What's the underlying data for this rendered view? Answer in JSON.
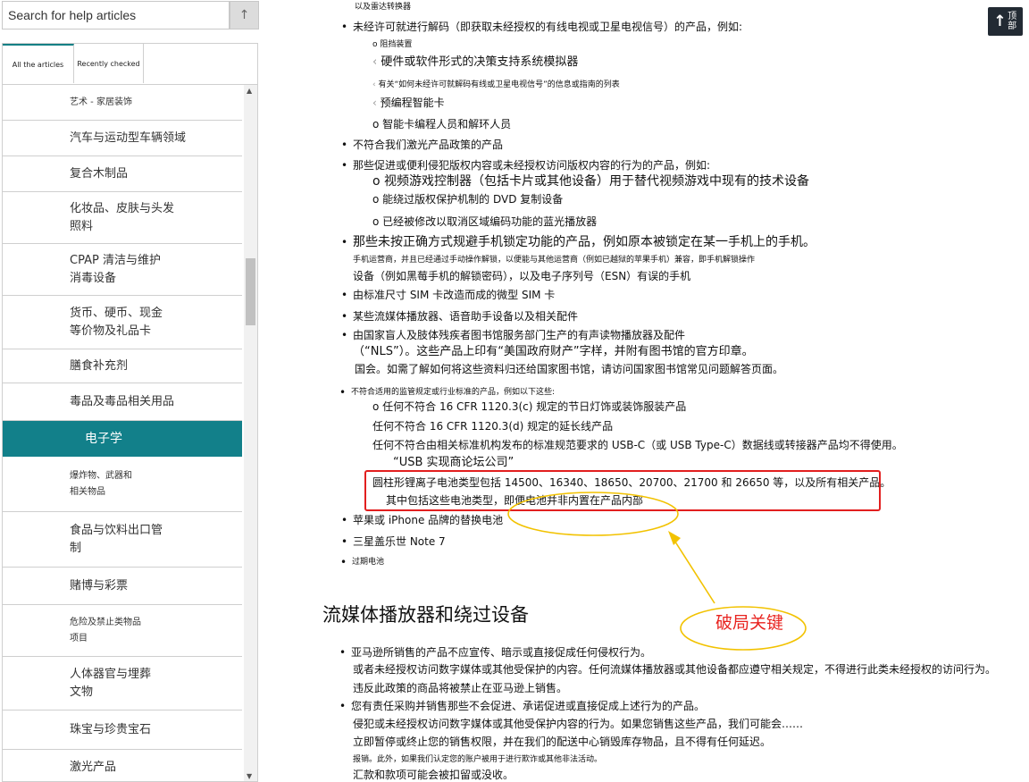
{
  "search": {
    "placeholder": "Search for help articles",
    "button_icon": "↑"
  },
  "tabs": [
    {
      "label": "All the articles",
      "active": true
    },
    {
      "label": "Recently checked",
      "active": false
    }
  ],
  "categories": [
    {
      "label": "艺术 - 家居装饰",
      "size": "small"
    },
    {
      "label": "汽车与运动型车辆领域",
      "size": "normal"
    },
    {
      "label": "复合木制品",
      "size": "normal"
    },
    {
      "label": "化妆品、皮肤与头发\n照料",
      "size": "normal"
    },
    {
      "label": "CPAP 清洁与维护\n消毒设备",
      "size": "normal"
    },
    {
      "label": "货币、硬币、现金\n等价物及礼品卡",
      "size": "normal"
    },
    {
      "label": "膳食补充剂",
      "size": "normal"
    },
    {
      "label": "毒品及毒品相关用品",
      "size": "normal"
    },
    {
      "label": "电子学",
      "size": "normal",
      "active": true
    },
    {
      "label": "爆炸物、武器和\n相关物品",
      "size": "small"
    },
    {
      "label": "食品与饮料出口管\n制",
      "size": "normal"
    },
    {
      "label": "赌博与彩票",
      "size": "normal"
    },
    {
      "label": "危险及禁止类物品\n项目",
      "size": "small"
    },
    {
      "label": "人体器官与埋葬\n文物",
      "size": "normal"
    },
    {
      "label": "珠宝与珍贵宝石",
      "size": "normal"
    },
    {
      "label": "激光产品",
      "size": "normal"
    }
  ],
  "top_button": {
    "arrow": "↑",
    "label": "顶部"
  },
  "content_lines": [
    "以及雷达转换器",
    "未经许可就进行解码（即获取未经授权的有线电视或卫星电视信号）的产品，例如:",
    "阻挡装置",
    "硬件或软件形式的决策支持系统模拟器",
    "有关“如何未经许可就解码有线或卫星电视信号”的信息或指南的列表",
    "预编程智能卡",
    "智能卡编程人员和解环人员",
    "不符合我们激光产品政策的产品",
    "那些促进或便利侵犯版权内容或未经授权访问版权内容的行为的产品，例如:",
    "视频游戏控制器（包括卡片或其他设备）用于替代视频游戏中现有的技术设备",
    "能绕过版权保护机制的 DVD 复制设备",
    "已经被修改以取消区域编码功能的蓝光播放器",
    "那些未按正确方式规避手机锁定功能的产品，例如原本被锁定在某一手机上的手机。",
    "手机运营商，并且已经通过手动操作解锁，以便能与其他运营商（例如已越狱的苹果手机）兼容，即手机解锁操作",
    "设备（例如黑莓手机的解锁密码），以及电子序列号（ESN）有误的手机",
    "由标准尺寸 SIM 卡改造而成的微型 SIM 卡",
    "某些流媒体播放器、语音助手设备以及相关配件",
    "由国家盲人及肢体残疾者图书馆服务部门生产的有声读物播放器及配件",
    "（“NLS”）。这些产品上印有“美国政府财产”字样，并附有图书馆的官方印章。",
    "国会。如需了解如何将这些资料归还给国家图书馆，请访问国家图书馆常见问题解答页面。",
    "不符合适用的监管规定或行业标准的产品，例如以下这些:",
    "任何不符合 16 CFR 1120.3(c) 规定的节日灯饰或装饰服装产品",
    "任何不符合 16 CFR 1120.3(d) 规定的延长线产品",
    "任何不符合由相关标准机构发布的标准规范要求的 USB-C（或 USB Type-C）数据线或转接器产品均不得使用。",
    "“USB 实现商论坛公司”",
    "圆柱形锂离子电池类型包括 14500、16340、18650、20700、21700 和 26650 等，以及所有相关产品。",
    "其中包括这些电池类型，即便电池并非内置在产品内部",
    "苹果或 iPhone 品牌的替换电池",
    "三星盖乐世 Note 7",
    "过期电池"
  ],
  "section_heading": "流媒体播放器和绕过设备",
  "section_lines": [
    "亚马逊所销售的产品不应宣传、暗示或直接促成任何侵权行为。",
    "或者未经授权访问数字媒体或其他受保护的内容。任何流媒体播放器或其他设备都应遵守相关规定，不得进行此类未经授权的访问行为。",
    "违反此政策的商品将被禁止在亚马逊上销售。",
    "您有责任采购并销售那些不会促进、承诺促进或直接促成上述行为的产品。",
    "侵犯或未经授权访问数字媒体或其他受保护内容的行为。如果您销售这些产品，我们可能会……",
    "立即暂停或终止您的销售权限，并在我们的配送中心销毁库存物品，且不得有任何延迟。",
    "报销。此外，如果我们认定您的账户被用于进行欺诈或其他非法活动。",
    "汇款和款项可能会被扣留或没收。"
  ],
  "annotation": {
    "text": "破局关键",
    "box_color": "#e21f1f",
    "highlight_color": "#f2c200"
  },
  "colors": {
    "accent": "#12808a",
    "top_button_bg": "#222a33"
  }
}
